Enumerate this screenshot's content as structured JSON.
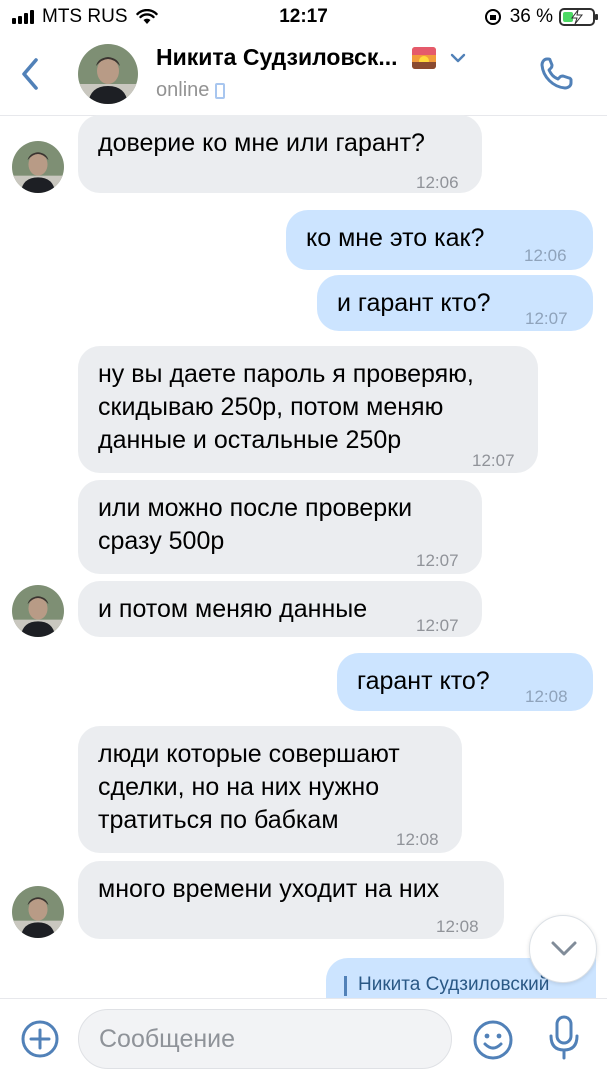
{
  "status_bar": {
    "carrier": "MTS RUS",
    "time": "12:17",
    "battery": "36 %",
    "battery_level": 0.36
  },
  "header": {
    "contact_name": "Никита Судзиловск...",
    "status": "online"
  },
  "messages": [
    {
      "dir": "in",
      "lines": [
        "доверие ко мне или гарант?"
      ],
      "time": "12:06",
      "avatar": true
    },
    {
      "dir": "out",
      "lines": [
        "ко мне это как?"
      ],
      "time": "12:06"
    },
    {
      "dir": "out",
      "lines": [
        "и гарант кто?"
      ],
      "time": "12:07"
    },
    {
      "dir": "in",
      "lines": [
        "ну вы даете пароль я проверяю,",
        "скидываю 250р, потом меняю",
        "данные и остальные 250р"
      ],
      "time": "12:07"
    },
    {
      "dir": "in",
      "lines": [
        "или можно после проверки",
        "сразу 500р"
      ],
      "time": "12:07"
    },
    {
      "dir": "in",
      "lines": [
        "и потом меняю данные"
      ],
      "time": "12:07",
      "avatar": true
    },
    {
      "dir": "out",
      "lines": [
        "гарант кто?"
      ],
      "time": "12:08"
    },
    {
      "dir": "in",
      "lines": [
        "люди которые совершают",
        "сделки, но на них нужно",
        "тратиться по бабкам"
      ],
      "time": "12:08"
    },
    {
      "dir": "in",
      "lines": [
        "много времени уходит на них"
      ],
      "time": "12:08",
      "avatar": true
    }
  ],
  "reply_preview": {
    "name": "Никита Судзиловский"
  },
  "composer": {
    "placeholder": "Сообщение"
  },
  "colors": {
    "accent": "#2a5885",
    "icon_blue": "#5181b8",
    "incoming_bubble": "#ebedf0",
    "outgoing_bubble": "#cce4ff"
  },
  "icons": [
    "back-chevron-icon",
    "dropdown-chevron-icon",
    "phone-icon",
    "plus-circle-icon",
    "smiley-icon",
    "microphone-icon",
    "scroll-down-chevron-icon",
    "wifi-icon",
    "signal-icon",
    "battery-icon"
  ]
}
